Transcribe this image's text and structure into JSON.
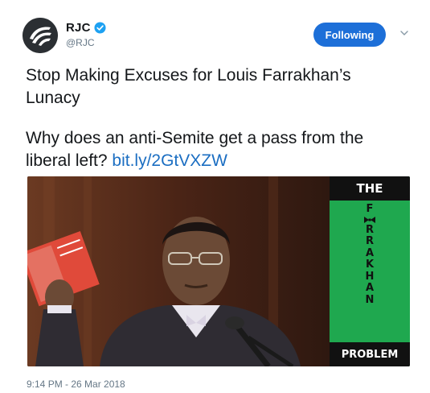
{
  "author": {
    "display_name": "RJC",
    "handle": "@RJC",
    "verified": true,
    "avatar_icon": "rjc-logo-icon"
  },
  "actions": {
    "follow_label": "Following",
    "follow_color": "#1d6fd8",
    "more_icon": "chevron-down-icon"
  },
  "tweet": {
    "line1": "Stop Making Excuses for Louis Farrakhan’s Lunacy",
    "line2_text": "Why does an anti-Semite get a pass from the liberal left? ",
    "line2_link": "bit.ly/2GtVXZW",
    "link_color": "#1b6ec2"
  },
  "media": {
    "cover_top": "THE",
    "cover_letters": [
      "F",
      "R",
      "R",
      "A",
      "K",
      "H",
      "A",
      "N"
    ],
    "cover_bottom": "PROBLEM",
    "cover_color": "#1fa84f"
  },
  "meta": {
    "timestamp": "9:14 PM - 26 Mar 2018"
  }
}
